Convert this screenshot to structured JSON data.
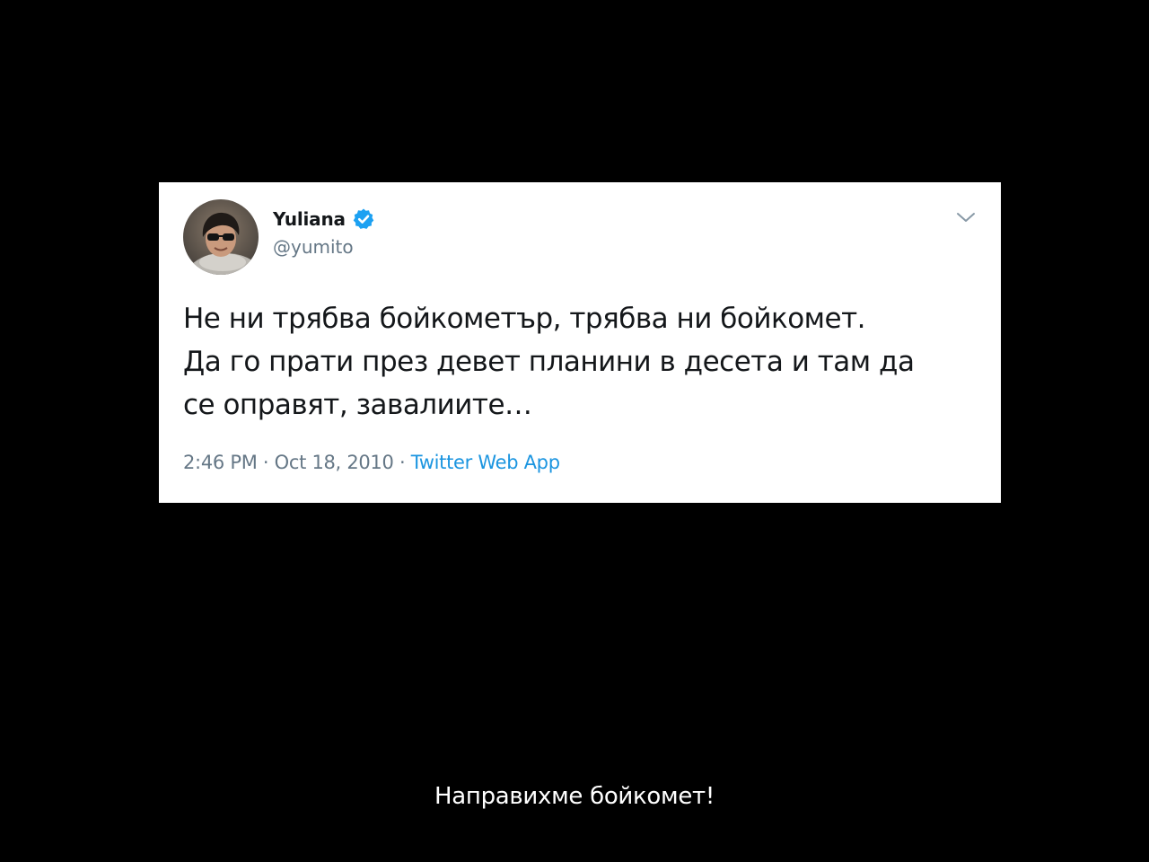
{
  "tweet": {
    "author": {
      "display_name": "Yuliana",
      "handle": "@yumito",
      "verified": true,
      "avatar_icon": "profile-photo"
    },
    "text_lines": [
      "Не ни трябва бойкометър, трябва ни бойкомет.",
      "Да го прати през девет планини в десета и там да",
      "се оправят, завалиите…"
    ],
    "time": "2:46 PM",
    "date": "Oct 18, 2010",
    "separator": " · ",
    "source": "Twitter Web App",
    "menu_icon": "chevron-down-icon"
  },
  "caption": "Направихме бойкомет!",
  "colors": {
    "background": "#000000",
    "card": "#ffffff",
    "text": "#14171a",
    "muted": "#657786",
    "link": "#1b95e0",
    "verified": "#1da1f2"
  }
}
